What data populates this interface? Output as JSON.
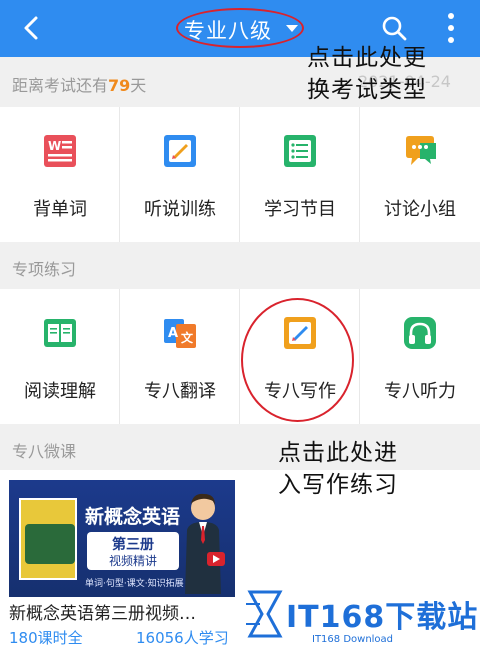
{
  "header": {
    "title": "专业八级",
    "back_icon": "chevron-left-icon",
    "search_icon": "search-icon",
    "more_icon": "more-vertical-icon"
  },
  "countdown": {
    "prefix": "距离考试还有",
    "days": "79",
    "suffix": "天",
    "date": "2021-04-24"
  },
  "main_menu": [
    {
      "label": "背单词",
      "icon": "word-card-icon",
      "color": "#e9505a"
    },
    {
      "label": "听说训练",
      "icon": "pen-note-icon",
      "color": "#2f8cf0"
    },
    {
      "label": "学习节目",
      "icon": "list-icon",
      "color": "#27b36b"
    },
    {
      "label": "讨论小组",
      "icon": "chat-bubble-icon",
      "color": "#f0a01d"
    }
  ],
  "special": {
    "section_title": "专项练习",
    "items": [
      {
        "label": "阅读理解",
        "icon": "open-book-icon",
        "color": "#27b36b"
      },
      {
        "label": "专八翻译",
        "icon": "translate-icon",
        "color": "#2f8cf0"
      },
      {
        "label": "专八写作",
        "icon": "pen-note-icon",
        "color": "#f0a01d"
      },
      {
        "label": "专八听力",
        "icon": "headphones-icon",
        "color": "#27b36b"
      }
    ]
  },
  "courses": {
    "section_title": "专八微课",
    "items": [
      {
        "title": "新概念英语第三册视频…",
        "lessons": "180课时全",
        "learners": "16056人学习",
        "thumb_title": "新概念英语",
        "thumb_box_line1": "第三册",
        "thumb_box_line2": "视频精讲",
        "thumb_small": "单词·句型·课文·知识拓展"
      }
    ]
  },
  "annotations": {
    "top_line1": "点击此处更",
    "top_line2": "换考试类型",
    "mid_line1": "点击此处进",
    "mid_line2": "入写作练习"
  },
  "watermark": {
    "text": "IT168下载站",
    "sub": "IT168 Download"
  }
}
